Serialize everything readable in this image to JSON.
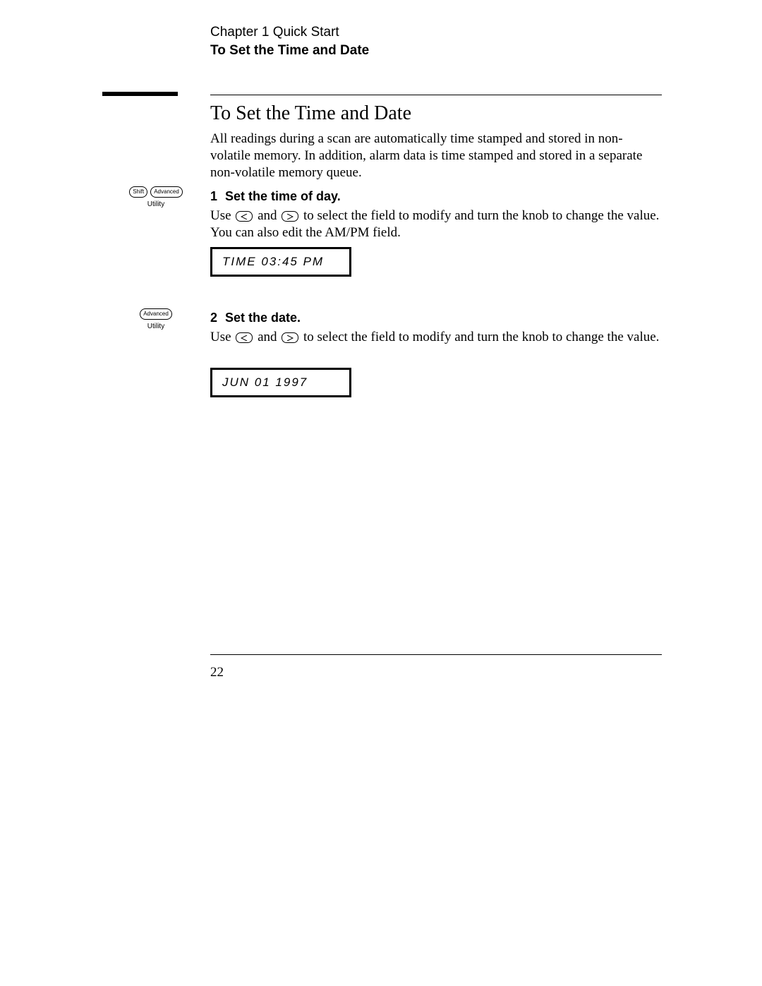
{
  "header": {
    "chapter_line": "Chapter 1  Quick Start",
    "subtitle": "To Set the Time and Date"
  },
  "section_title": "To Set the Time and Date",
  "intro": "All readings during a scan are automatically time stamped and stored in non-volatile memory. In addition, alarm data is time stamped and stored in a separate non-volatile memory queue.",
  "step1": {
    "num": "1",
    "heading": "Set the time of day.",
    "body_pre": "Use ",
    "body_mid": " and ",
    "body_post": " to select the field to modify and turn the knob to change the value. You can also edit the AM/PM field.",
    "display": "TIME 03:45 PM",
    "margin": {
      "shift": "Shift",
      "advanced": "Advanced",
      "utility": "Utility"
    }
  },
  "step2": {
    "num": "2",
    "heading": "Set the date.",
    "body_pre": "Use ",
    "body_mid": " and ",
    "body_post": " to select the field to modify and turn the knob to change the value.",
    "display": "JUN 01 1997",
    "margin": {
      "advanced": "Advanced",
      "utility": "Utility"
    }
  },
  "page_number": "22"
}
